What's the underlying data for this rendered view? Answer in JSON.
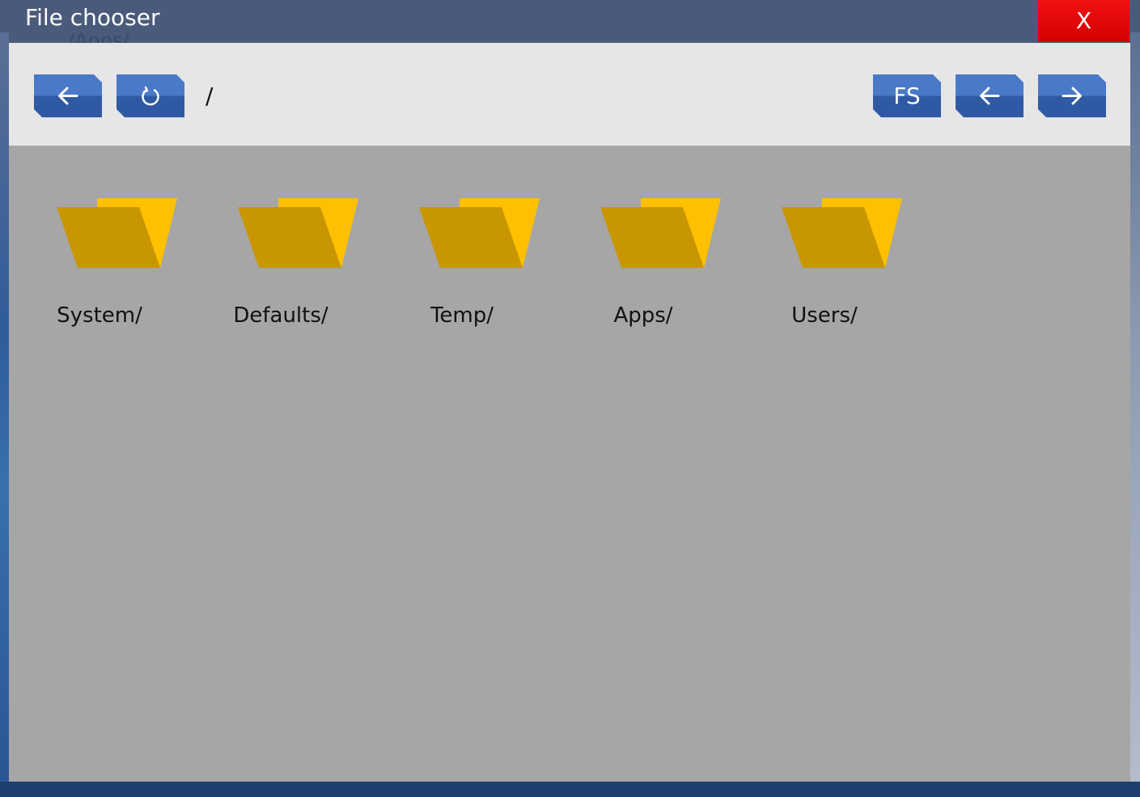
{
  "window": {
    "title": "File chooser",
    "close_label": "X",
    "background_path": "/Apps/"
  },
  "toolbar": {
    "current_path": "/",
    "fs_label": "FS",
    "buttons": {
      "up": "arrow-left-icon",
      "refresh": "refresh-icon",
      "back": "arrow-left-icon",
      "forward": "arrow-right-icon"
    }
  },
  "folders": [
    {
      "name": "System/"
    },
    {
      "name": "Defaults/"
    },
    {
      "name": "Temp/"
    },
    {
      "name": "Apps/"
    },
    {
      "name": "Users/"
    }
  ],
  "colors": {
    "close": "#e00000",
    "button": "#3a66b4",
    "toolbar": "#e6e6e7",
    "content": "#a6a6a6",
    "folder_front": "#c89600",
    "folder_back": "#ffc000"
  }
}
